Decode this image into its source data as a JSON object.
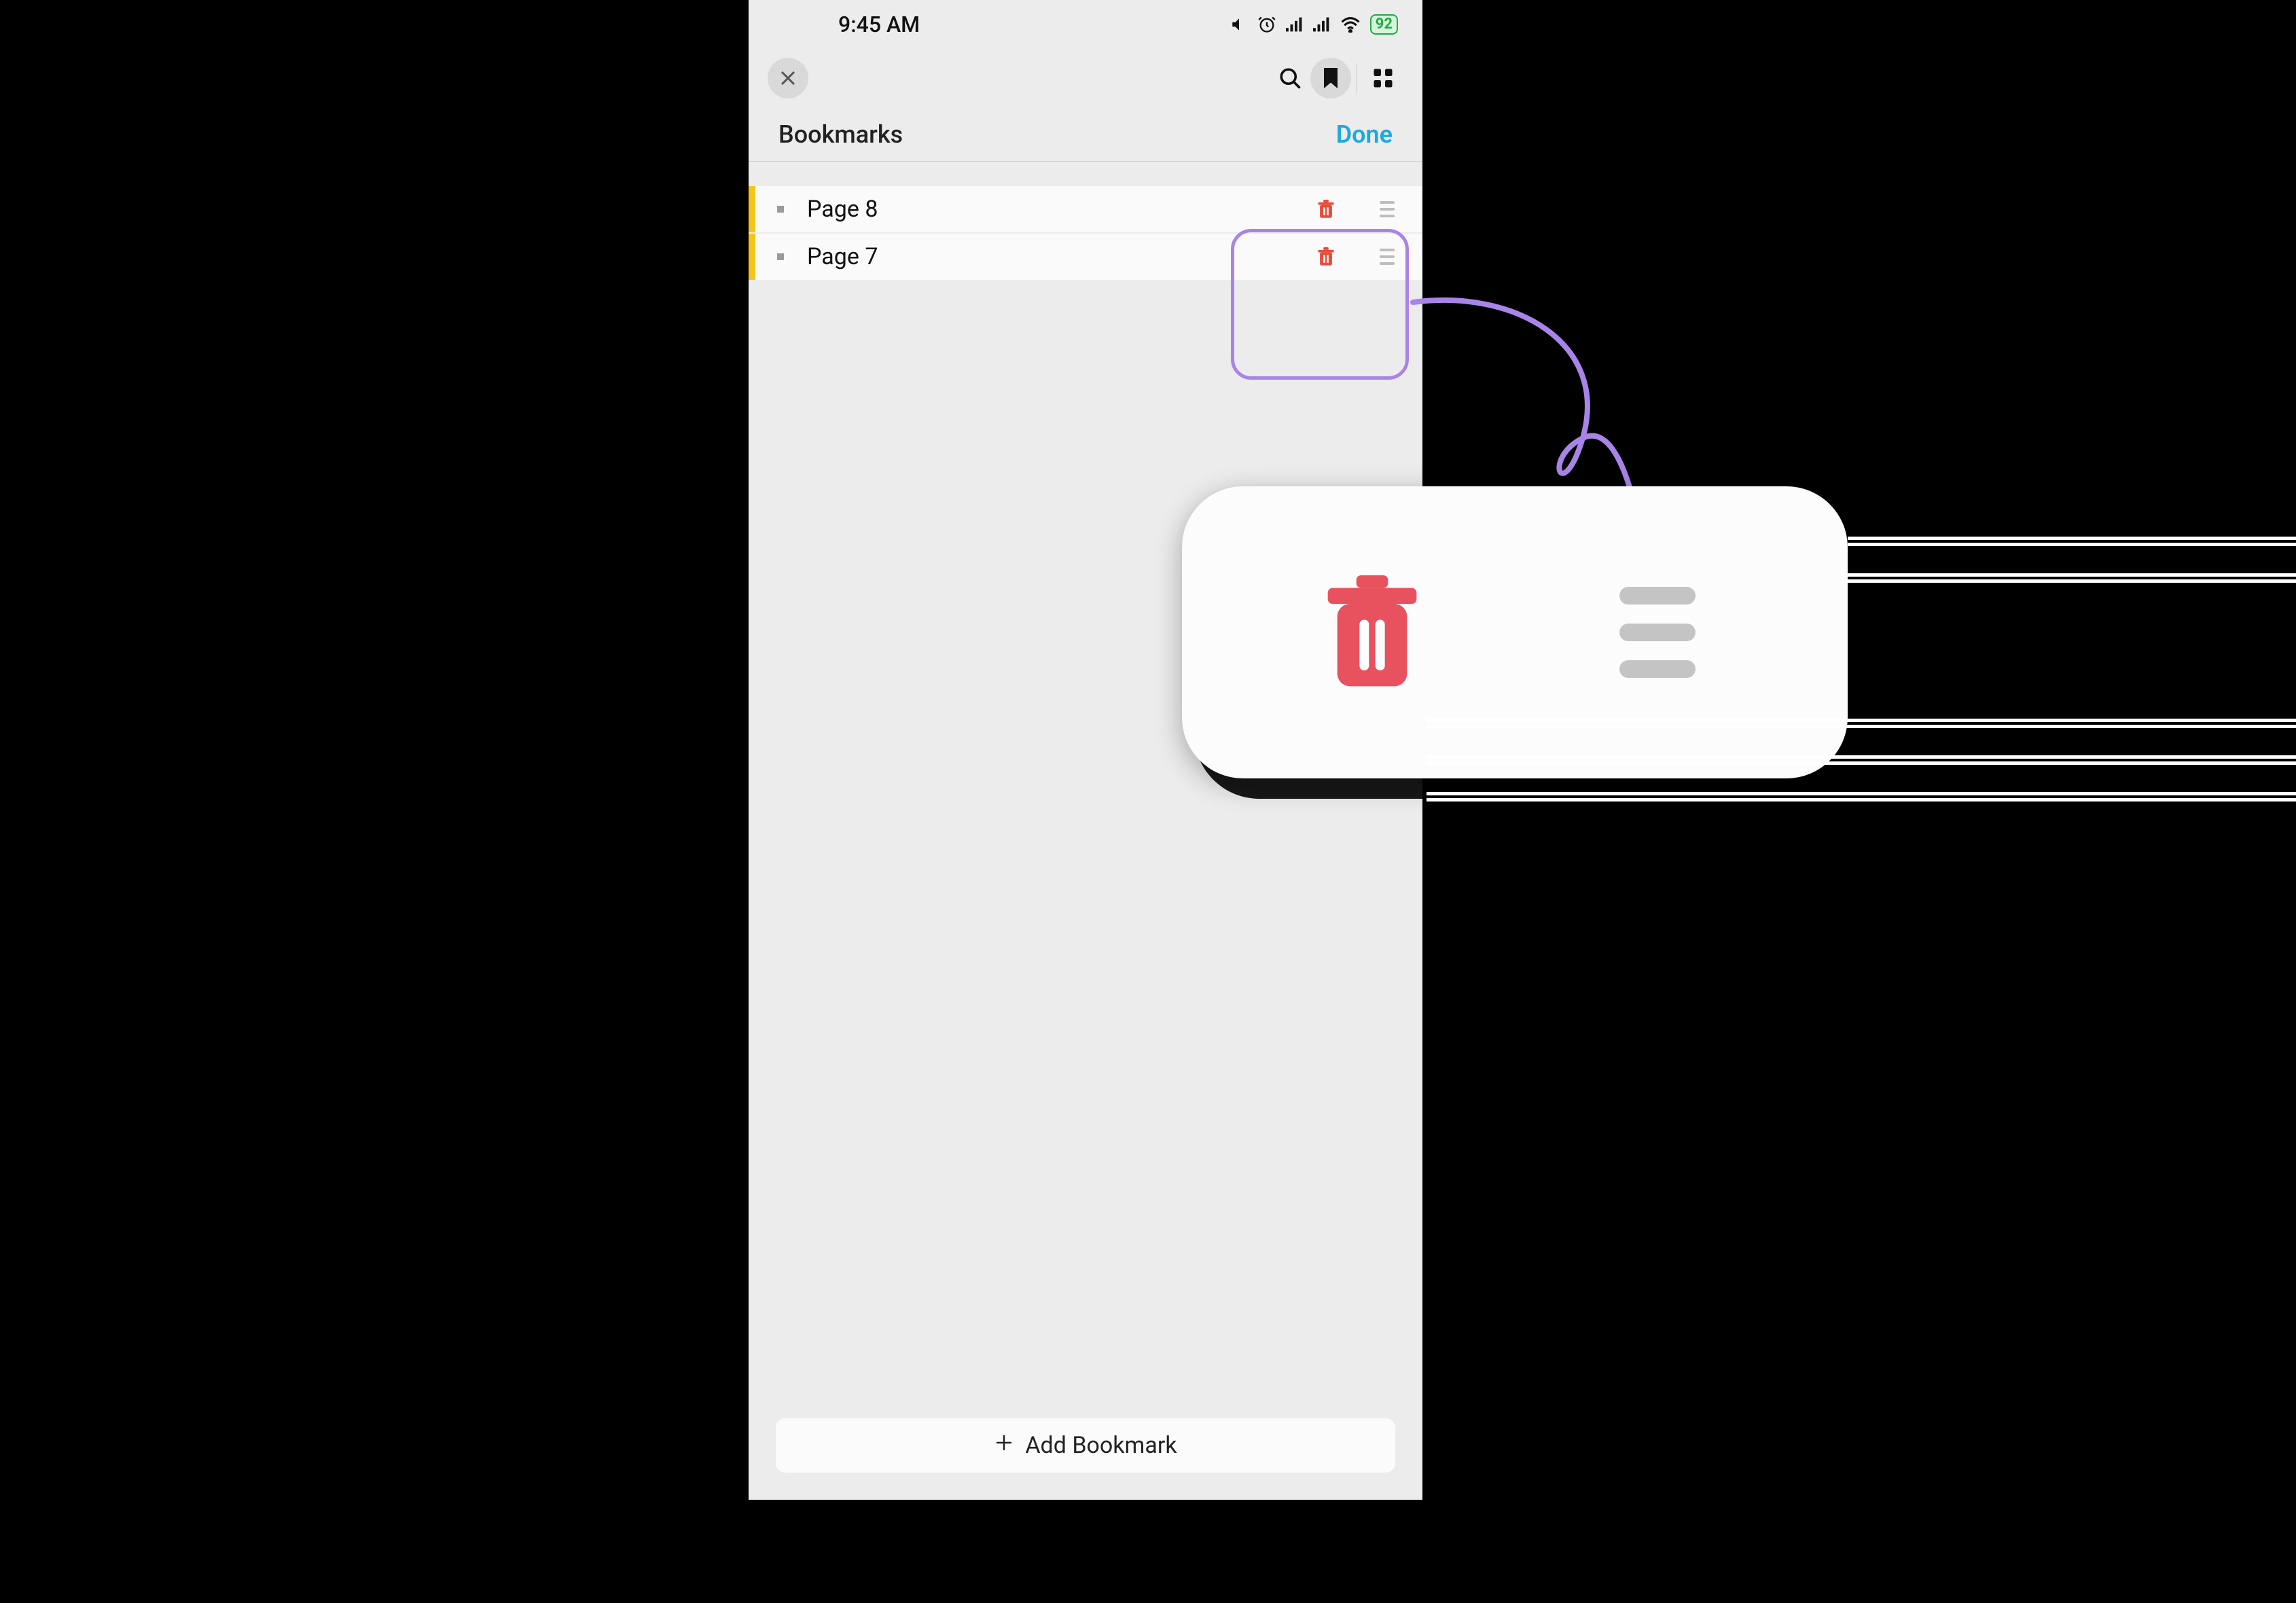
{
  "status_bar": {
    "time": "9:45 AM",
    "battery_percent": "92"
  },
  "toolbar": {
    "close": "×",
    "search": "search",
    "bookmark": "bookmark",
    "grid": "grid"
  },
  "subheader": {
    "title": "Bookmarks",
    "done_label": "Done"
  },
  "bookmarks": [
    {
      "label": "Page 8"
    },
    {
      "label": "Page 7"
    }
  ],
  "footer": {
    "add_label": "Add Bookmark"
  },
  "callout": {
    "delete_icon": "trash",
    "reorder_icon": "drag-handle"
  }
}
